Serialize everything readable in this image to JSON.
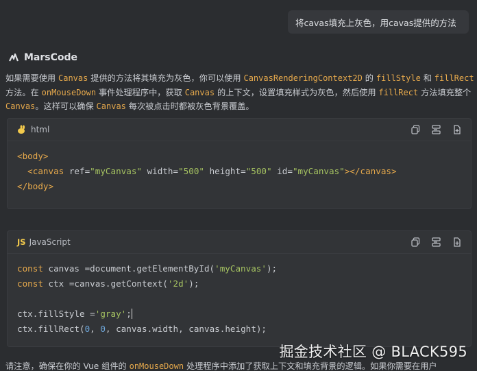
{
  "user_message": "将cavas填充上灰色，用cavas提供的方法",
  "assistant": {
    "name": "MarsCode"
  },
  "answer": {
    "p1": "如果需要使用 ",
    "c1": "Canvas",
    "p2": " 提供的方法将其填充为灰色，你可以使用 ",
    "c2": "CanvasRenderingContext2D",
    "p3": " 的 ",
    "c3": "fillStyle",
    "p4": " 和 ",
    "c4": "fillRect",
    "p5": " 方法。在 ",
    "c5": "onMouseDown",
    "p6": " 事件处理程序中，获取 ",
    "c6": "Canvas",
    "p7": " 的上下文，设置填充样式为灰色，然后使用 ",
    "c7": "fillRect",
    "p8": " 方法填充整个 ",
    "c8": "Canvas",
    "p9": "。这样可以确保 ",
    "c9": "Canvas",
    "p10": " 每次被点击时都被灰色背景覆盖。"
  },
  "code_block_1": {
    "language": "html",
    "lines": {
      "l1_open": "<body>",
      "l2_indent": "  ",
      "l2_tag_open": "<canvas",
      "l2_attr1": " ref=",
      "l2_val1": "\"myCanvas\"",
      "l2_attr2": " width=",
      "l2_val2": "\"500\"",
      "l2_attr3": " height=",
      "l2_val3": "\"500\"",
      "l2_attr4": " id=",
      "l2_val4": "\"myCanvas\"",
      "l2_tag_close": "></canvas>",
      "l3_close": "</body>"
    }
  },
  "code_block_2": {
    "language_badge": "JS",
    "language": "JavaScript",
    "lines": {
      "l1_kw": "const",
      "l1_rest": " canvas =document.getElementById(",
      "l1_str": "'myCanvas'",
      "l1_end": ");",
      "l2_kw": "const",
      "l2_rest": " ctx =canvas.getContext(",
      "l2_str": "'2d'",
      "l2_end": ");",
      "l4_rest": "ctx.fillStyle =",
      "l4_str": "'gray'",
      "l4_end": ";",
      "l5_rest": "ctx.fillRect(",
      "l5_n1": "0",
      "l5_sep": ", ",
      "l5_n2": "0",
      "l5_tail": ", canvas.width, canvas.height);"
    }
  },
  "footer_text": {
    "t1": "请注意，确保在你的 Vue 组件的 ",
    "c1": "onMouseDown",
    "t2": " 处理程序中添加了获取上下文和填充背景的逻辑。如果你需要在用户"
  },
  "watermark": "掘金技术社区 @ BLACK595",
  "icons": [
    "copy-icon",
    "insert-icon",
    "new-file-icon"
  ],
  "colors": {
    "background": "#2b2d30",
    "code_bg": "#323437",
    "code_keyword": "#e6a94c",
    "code_string": "#a5c261",
    "code_number": "#6fa8dc"
  }
}
